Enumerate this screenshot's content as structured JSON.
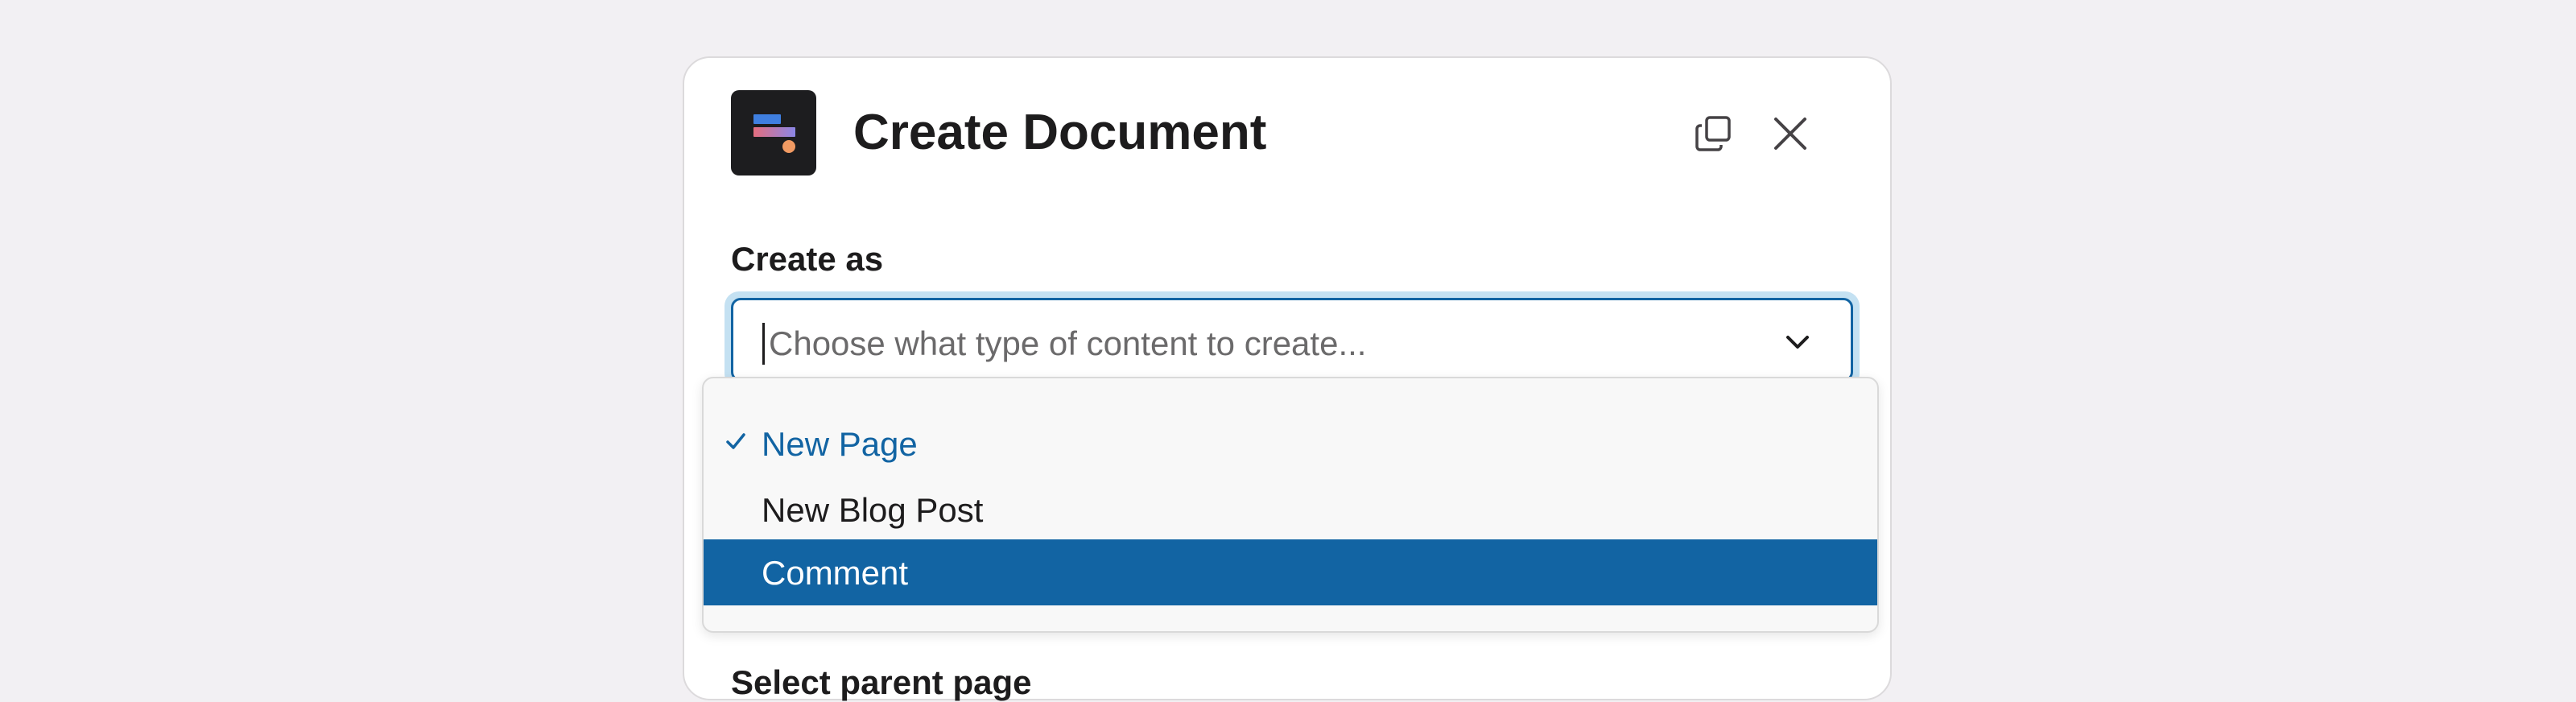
{
  "modal": {
    "title": "Create Document",
    "icons": {
      "app": "app-logo-icon",
      "copy": "copy-icon",
      "close": "close-icon"
    }
  },
  "form": {
    "create_as": {
      "label": "Create as",
      "placeholder": "Choose what type of content to create..."
    },
    "parent_page": {
      "label": "Select parent page"
    }
  },
  "dropdown": {
    "options": [
      {
        "label": "New Page",
        "state": "selected"
      },
      {
        "label": "New Blog Post",
        "state": "normal"
      },
      {
        "label": "Comment",
        "state": "highlighted"
      }
    ]
  },
  "colors": {
    "accent": "#1264a3",
    "focus_ring": "#c4e1f2",
    "background": "#f2f0f3"
  }
}
